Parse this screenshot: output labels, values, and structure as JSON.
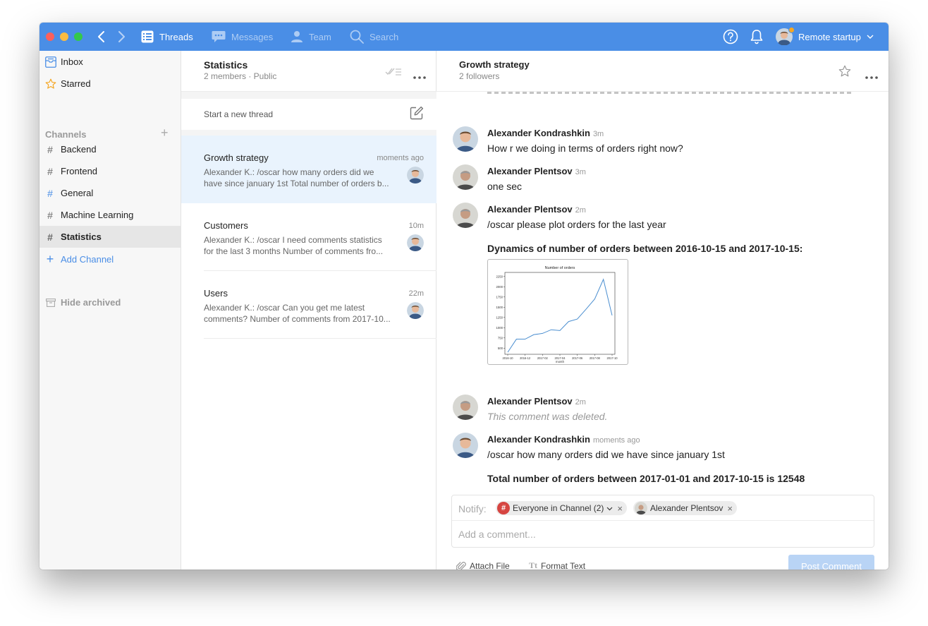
{
  "nav": {
    "threads": "Threads",
    "messages": "Messages",
    "team": "Team",
    "search": "Search",
    "account": "Remote startup"
  },
  "sidebar": {
    "inbox": "Inbox",
    "starred": "Starred",
    "channels_header": "Channels",
    "channels": [
      {
        "name": "Backend"
      },
      {
        "name": "Frontend"
      },
      {
        "name": "General"
      },
      {
        "name": "Machine Learning"
      },
      {
        "name": "Statistics",
        "selected": true
      }
    ],
    "add_channel": "Add Channel",
    "hide_archived": "Hide archived"
  },
  "threads_panel": {
    "title": "Statistics",
    "subtitle": "2 members · Public",
    "new_thread": "Start a new thread",
    "threads": [
      {
        "name": "Growth strategy",
        "time": "moments ago",
        "snippet_line1": "Alexander K.: /oscar how many orders did we",
        "snippet_line2": "have since january 1st  Total number of orders b...",
        "active": true
      },
      {
        "name": "Customers",
        "time": "10m",
        "snippet_line1": "Alexander K.: /oscar I need comments statistics",
        "snippet_line2": "for the last 3 months  Number of comments fro..."
      },
      {
        "name": "Users",
        "time": "22m",
        "snippet_line1": "Alexander K.: /oscar Can you get me latest",
        "snippet_line2": "comments?  Number of comments from 2017-10..."
      }
    ]
  },
  "conversation": {
    "title": "Growth strategy",
    "subtitle": "2 followers",
    "messages": [
      {
        "author": "Alexander Kondrashkin",
        "time": "3m",
        "text": "How r we doing in terms of orders right now?"
      },
      {
        "author": "Alexander Plentsov",
        "time": "3m",
        "text": "one sec"
      },
      {
        "author": "Alexander Plentsov",
        "time": "2m",
        "text": "/oscar please plot orders for the last year",
        "bold": "Dynamics of number of orders between 2016-10-15 and 2017-10-15:",
        "link": "source"
      },
      {
        "author": "Alexander Plentsov",
        "time": "2m",
        "text": "This comment was deleted."
      },
      {
        "author": "Alexander Kondrashkin",
        "time": "moments ago",
        "text": "/oscar how many orders did we have since january 1st",
        "bold": "Total number of orders between 2017-01-01 and 2017-10-15 is 12548"
      }
    ],
    "notify_label": "Notify:",
    "notify_chips": [
      "Everyone in Channel (2)",
      "Alexander Plentsov"
    ],
    "comment_placeholder": "Add a comment...",
    "attach_file": "Attach File",
    "format_text_icon": "Tt",
    "format_text": "Format Text",
    "post_comment": "Post Comment"
  },
  "colors": {
    "titlebar": "#4a8ee6",
    "accent": "#4a8ee6",
    "active_thread": "#e9f3fd",
    "chart_line": "#4c8fd0"
  },
  "chart_data": {
    "type": "line",
    "title": "Number of orders",
    "xlabel": "month",
    "ylabel": "",
    "x": [
      "2016-10",
      "2016-11",
      "2016-12",
      "2017-01",
      "2017-02",
      "2017-03",
      "2017-04",
      "2017-05",
      "2017-06",
      "2017-07",
      "2017-08",
      "2017-09",
      "2017-10"
    ],
    "xticks": [
      "2016-10",
      "2016-12",
      "2017-02",
      "2017-04",
      "2017-06",
      "2017-08",
      "2017-10"
    ],
    "yticks": [
      500,
      750,
      1000,
      1250,
      1500,
      1750,
      2000,
      2250
    ],
    "values": [
      400,
      720,
      720,
      830,
      860,
      950,
      930,
      1150,
      1210,
      1450,
      1700,
      2180,
      1300
    ],
    "ylim": [
      350,
      2350
    ],
    "grid": false
  }
}
